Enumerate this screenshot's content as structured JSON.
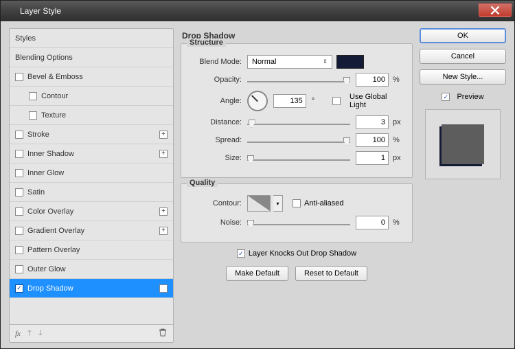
{
  "window": {
    "title": "Layer Style"
  },
  "sidebar": {
    "items": [
      {
        "label": "Styles",
        "type": "header"
      },
      {
        "label": "Blending Options",
        "type": "header"
      },
      {
        "label": "Bevel & Emboss",
        "type": "check",
        "plus": false
      },
      {
        "label": "Contour",
        "type": "check",
        "indent": true
      },
      {
        "label": "Texture",
        "type": "check",
        "indent": true
      },
      {
        "label": "Stroke",
        "type": "check",
        "plus": true
      },
      {
        "label": "Inner Shadow",
        "type": "check",
        "plus": true
      },
      {
        "label": "Inner Glow",
        "type": "check"
      },
      {
        "label": "Satin",
        "type": "check"
      },
      {
        "label": "Color Overlay",
        "type": "check",
        "plus": true
      },
      {
        "label": "Gradient Overlay",
        "type": "check",
        "plus": true
      },
      {
        "label": "Pattern Overlay",
        "type": "check"
      },
      {
        "label": "Outer Glow",
        "type": "check"
      },
      {
        "label": "Drop Shadow",
        "type": "check",
        "plus": true,
        "checked": true,
        "active": true
      }
    ],
    "fx_label": "fx"
  },
  "panel": {
    "title": "Drop Shadow",
    "structure": {
      "legend": "Structure",
      "blend_mode_label": "Blend Mode:",
      "blend_mode_value": "Normal",
      "color": "#131b36",
      "opacity_label": "Opacity:",
      "opacity_value": "100",
      "opacity_unit": "%",
      "angle_label": "Angle:",
      "angle_value": "135",
      "angle_unit": "°",
      "use_global_label": "Use Global Light",
      "use_global_checked": false,
      "distance_label": "Distance:",
      "distance_value": "3",
      "distance_unit": "px",
      "spread_label": "Spread:",
      "spread_value": "100",
      "spread_unit": "%",
      "size_label": "Size:",
      "size_value": "1",
      "size_unit": "px"
    },
    "quality": {
      "legend": "Quality",
      "contour_label": "Contour:",
      "antialias_label": "Anti-aliased",
      "antialias_checked": false,
      "noise_label": "Noise:",
      "noise_value": "0",
      "noise_unit": "%"
    },
    "knockout_label": "Layer Knocks Out Drop Shadow",
    "knockout_checked": true,
    "make_default": "Make Default",
    "reset_default": "Reset to Default"
  },
  "right": {
    "ok": "OK",
    "cancel": "Cancel",
    "new_style": "New Style...",
    "preview_label": "Preview",
    "preview_checked": true
  }
}
